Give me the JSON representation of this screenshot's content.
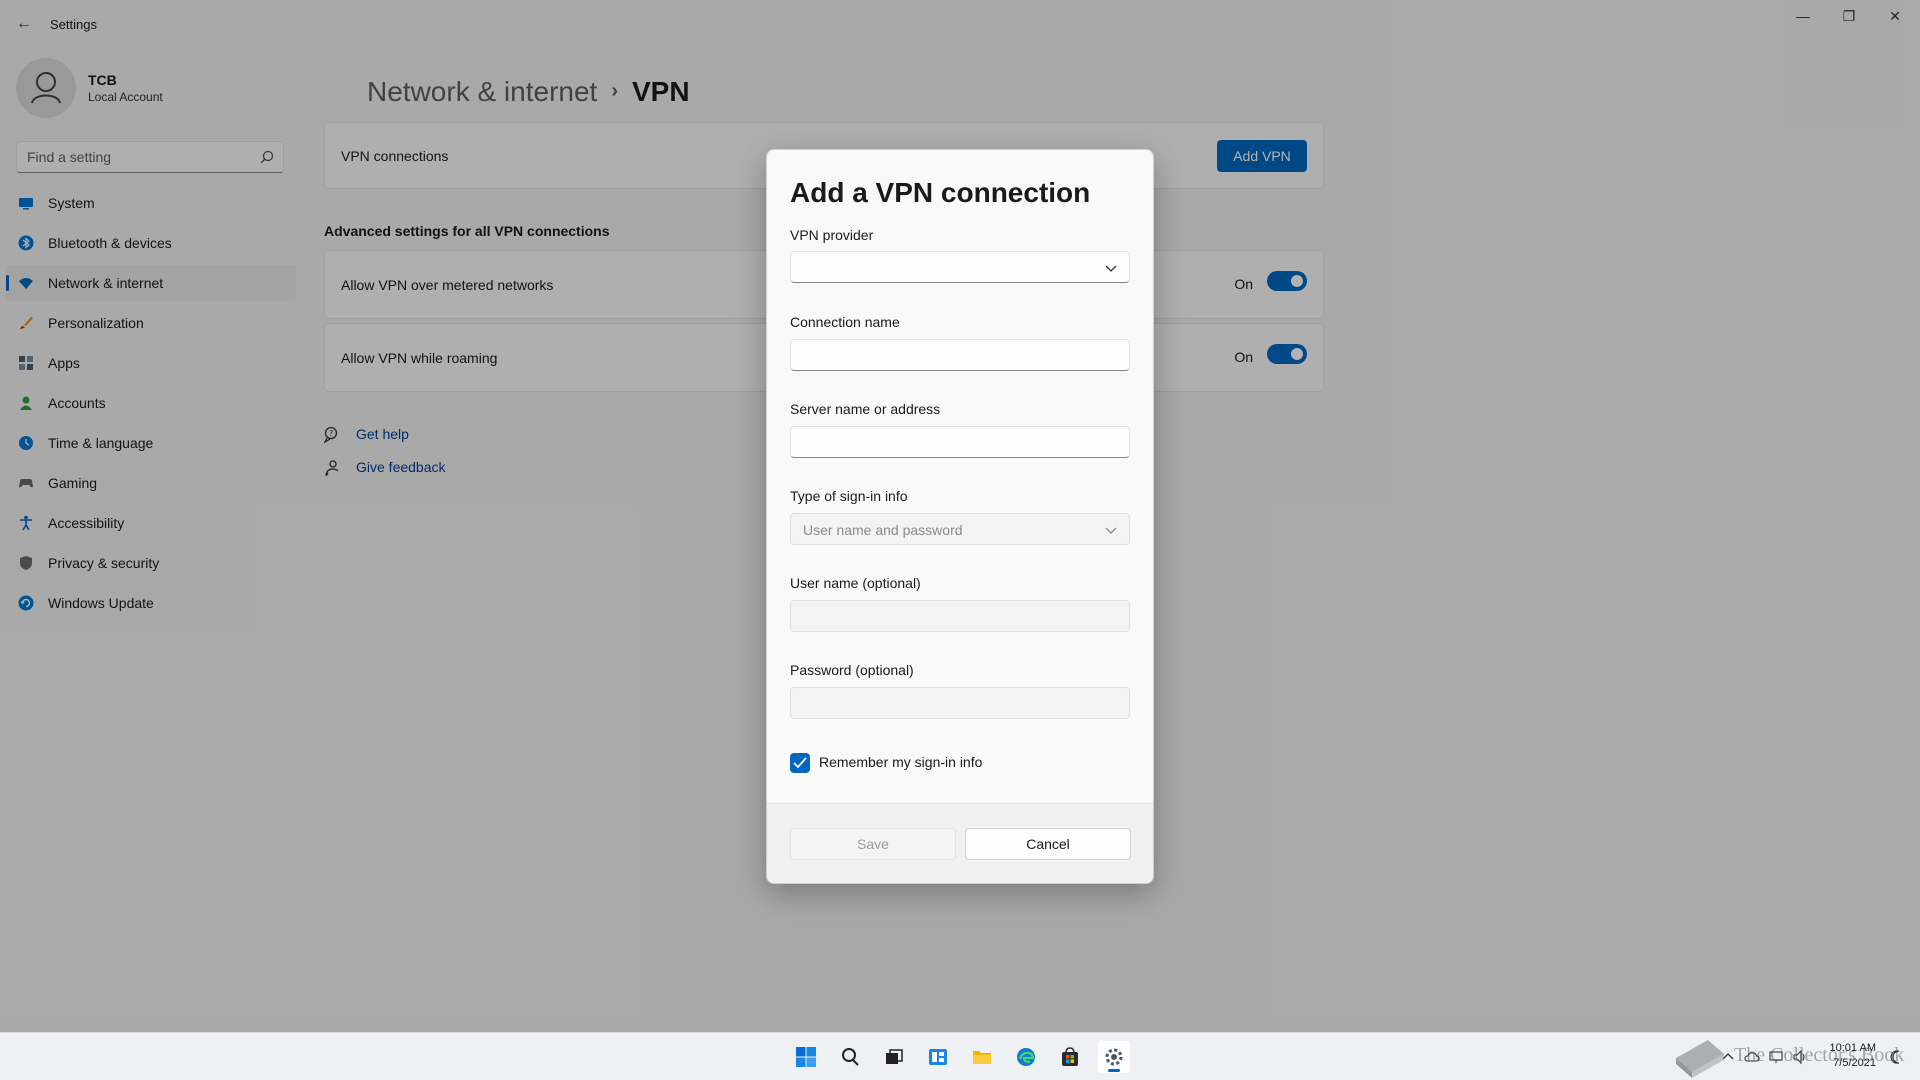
{
  "window": {
    "title": "Settings",
    "back_icon": "back-arrow-icon",
    "controls": {
      "minimize": "—",
      "restore": "❐",
      "close": "✕"
    }
  },
  "profile": {
    "name": "TCB",
    "account_type": "Local Account"
  },
  "search": {
    "placeholder": "Find a setting"
  },
  "sidebar": {
    "items": [
      {
        "label": "System",
        "icon": "monitor-icon",
        "color": "#0078d4"
      },
      {
        "label": "Bluetooth & devices",
        "icon": "bluetooth-icon",
        "color": "#0078d4"
      },
      {
        "label": "Network & internet",
        "icon": "wifi-icon",
        "color": "#0067c0",
        "active": true
      },
      {
        "label": "Personalization",
        "icon": "brush-icon",
        "color": "#e8912d"
      },
      {
        "label": "Apps",
        "icon": "apps-icon",
        "color": "#4b5d73"
      },
      {
        "label": "Accounts",
        "icon": "person-icon",
        "color": "#2ea043"
      },
      {
        "label": "Time & language",
        "icon": "globe-clock-icon",
        "color": "#0078d4"
      },
      {
        "label": "Gaming",
        "icon": "gamepad-icon",
        "color": "#6b6b6b"
      },
      {
        "label": "Accessibility",
        "icon": "accessibility-icon",
        "color": "#0067c0"
      },
      {
        "label": "Privacy & security",
        "icon": "shield-icon",
        "color": "#6b6b6b"
      },
      {
        "label": "Windows Update",
        "icon": "update-icon",
        "color": "#0078d4"
      }
    ]
  },
  "main": {
    "breadcrumb_parent": "Network & internet",
    "breadcrumb_separator": "›",
    "breadcrumb_current": "VPN",
    "vpn_connections_label": "VPN connections",
    "add_vpn_label": "Add VPN",
    "advanced_title": "Advanced settings for all VPN connections",
    "toggles": [
      {
        "label": "Allow VPN over metered networks",
        "state": "On",
        "on": true
      },
      {
        "label": "Allow VPN while roaming",
        "state": "On",
        "on": true
      }
    ],
    "get_help": "Get help",
    "give_feedback": "Give feedback"
  },
  "dialog": {
    "title": "Add a VPN connection",
    "vpn_provider_label": "VPN provider",
    "vpn_provider_value": "",
    "connection_name_label": "Connection name",
    "connection_name_value": "",
    "server_label": "Server name or address",
    "server_value": "",
    "signin_type_label": "Type of sign-in info",
    "signin_type_value": "User name and password",
    "username_label": "User name (optional)",
    "username_value": "",
    "password_label": "Password (optional)",
    "password_value": "",
    "remember_label": "Remember my sign-in info",
    "remember_checked": true,
    "save_label": "Save",
    "cancel_label": "Cancel"
  },
  "taskbar": {
    "apps": [
      {
        "name": "start",
        "icon": "windows-logo-icon"
      },
      {
        "name": "search",
        "icon": "search-icon"
      },
      {
        "name": "task-view",
        "icon": "task-view-icon"
      },
      {
        "name": "widgets",
        "icon": "widgets-icon"
      },
      {
        "name": "file-explorer",
        "icon": "folder-icon"
      },
      {
        "name": "edge",
        "icon": "edge-icon"
      },
      {
        "name": "store",
        "icon": "store-icon"
      },
      {
        "name": "settings",
        "icon": "gear-icon",
        "active": true
      }
    ],
    "time": "10:01 AM",
    "date": "7/5/2021"
  },
  "watermark": {
    "text": "The Collector's Book",
    "icon": "book-icon"
  }
}
